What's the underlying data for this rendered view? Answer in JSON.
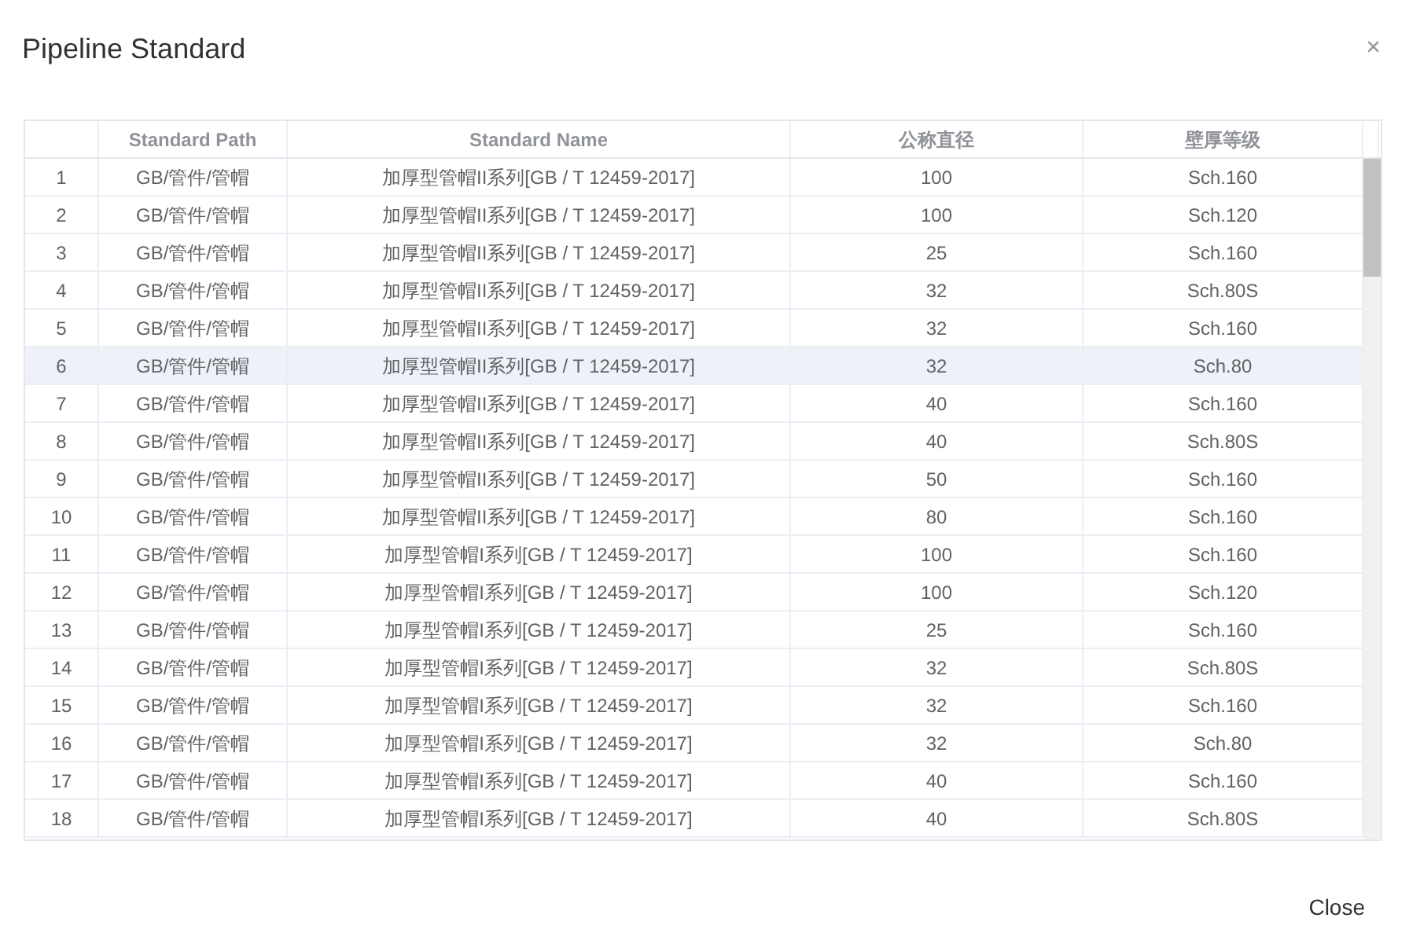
{
  "dialog": {
    "title": "Pipeline Standard",
    "close_symbol": "×"
  },
  "table": {
    "columns": [
      "",
      "Standard Path",
      "Standard Name",
      "公称直径",
      "壁厚等级"
    ],
    "rows": [
      {
        "cells": [
          "1",
          "GB/管件/管帽",
          "加厚型管帽II系列[GB / T 12459-2017]",
          "100",
          "Sch.160"
        ],
        "selected": false
      },
      {
        "cells": [
          "2",
          "GB/管件/管帽",
          "加厚型管帽II系列[GB / T 12459-2017]",
          "100",
          "Sch.120"
        ],
        "selected": false
      },
      {
        "cells": [
          "3",
          "GB/管件/管帽",
          "加厚型管帽II系列[GB / T 12459-2017]",
          "25",
          "Sch.160"
        ],
        "selected": false
      },
      {
        "cells": [
          "4",
          "GB/管件/管帽",
          "加厚型管帽II系列[GB / T 12459-2017]",
          "32",
          "Sch.80S"
        ],
        "selected": false
      },
      {
        "cells": [
          "5",
          "GB/管件/管帽",
          "加厚型管帽II系列[GB / T 12459-2017]",
          "32",
          "Sch.160"
        ],
        "selected": false
      },
      {
        "cells": [
          "6",
          "GB/管件/管帽",
          "加厚型管帽II系列[GB / T 12459-2017]",
          "32",
          "Sch.80"
        ],
        "selected": true
      },
      {
        "cells": [
          "7",
          "GB/管件/管帽",
          "加厚型管帽II系列[GB / T 12459-2017]",
          "40",
          "Sch.160"
        ],
        "selected": false
      },
      {
        "cells": [
          "8",
          "GB/管件/管帽",
          "加厚型管帽II系列[GB / T 12459-2017]",
          "40",
          "Sch.80S"
        ],
        "selected": false
      },
      {
        "cells": [
          "9",
          "GB/管件/管帽",
          "加厚型管帽II系列[GB / T 12459-2017]",
          "50",
          "Sch.160"
        ],
        "selected": false
      },
      {
        "cells": [
          "10",
          "GB/管件/管帽",
          "加厚型管帽II系列[GB / T 12459-2017]",
          "80",
          "Sch.160"
        ],
        "selected": false
      },
      {
        "cells": [
          "11",
          "GB/管件/管帽",
          "加厚型管帽I系列[GB / T 12459-2017]",
          "100",
          "Sch.160"
        ],
        "selected": false
      },
      {
        "cells": [
          "12",
          "GB/管件/管帽",
          "加厚型管帽I系列[GB / T 12459-2017]",
          "100",
          "Sch.120"
        ],
        "selected": false
      },
      {
        "cells": [
          "13",
          "GB/管件/管帽",
          "加厚型管帽I系列[GB / T 12459-2017]",
          "25",
          "Sch.160"
        ],
        "selected": false
      },
      {
        "cells": [
          "14",
          "GB/管件/管帽",
          "加厚型管帽I系列[GB / T 12459-2017]",
          "32",
          "Sch.80S"
        ],
        "selected": false
      },
      {
        "cells": [
          "15",
          "GB/管件/管帽",
          "加厚型管帽I系列[GB / T 12459-2017]",
          "32",
          "Sch.160"
        ],
        "selected": false
      },
      {
        "cells": [
          "16",
          "GB/管件/管帽",
          "加厚型管帽I系列[GB / T 12459-2017]",
          "32",
          "Sch.80"
        ],
        "selected": false
      },
      {
        "cells": [
          "17",
          "GB/管件/管帽",
          "加厚型管帽I系列[GB / T 12459-2017]",
          "40",
          "Sch.160"
        ],
        "selected": false
      },
      {
        "cells": [
          "18",
          "GB/管件/管帽",
          "加厚型管帽I系列[GB / T 12459-2017]",
          "40",
          "Sch.80S"
        ],
        "selected": false
      }
    ]
  },
  "footer": {
    "button": "Close"
  }
}
